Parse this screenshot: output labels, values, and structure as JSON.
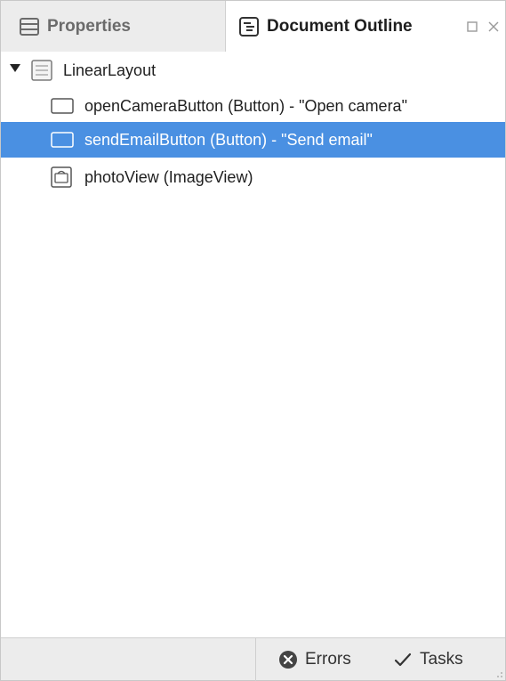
{
  "tabs": {
    "properties_label": "Properties",
    "outline_label": "Document Outline",
    "active": "Document Outline"
  },
  "tree": {
    "root": {
      "label": "LinearLayout",
      "icon": "layout-icon",
      "expanded": true
    },
    "children": [
      {
        "label": "openCameraButton (Button) - \"Open camera\"",
        "icon": "button-icon",
        "selected": false
      },
      {
        "label": "sendEmailButton (Button) - \"Send email\"",
        "icon": "button-icon",
        "selected": true
      },
      {
        "label": "photoView (ImageView)",
        "icon": "imageview-icon",
        "selected": false
      }
    ]
  },
  "statusbar": {
    "errors_label": "Errors",
    "tasks_label": "Tasks"
  },
  "colors": {
    "selection": "#4a90e2",
    "tabbar_bg": "#f3f3f3",
    "statusbar_bg": "#ececec"
  }
}
